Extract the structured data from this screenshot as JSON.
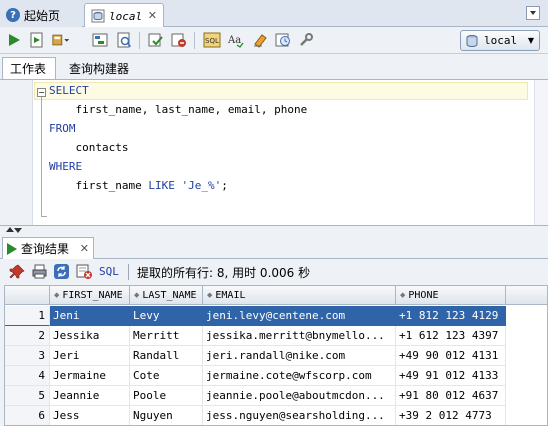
{
  "doc_tabs": {
    "start_page": "起始页",
    "worksheet": "local"
  },
  "toolbar": {
    "icons": [
      "run-statement-icon",
      "run-script-icon",
      "commit-dropdown-icon",
      "explain-plan-icon",
      "autotrace-icon",
      "commit-icon",
      "rollback-icon",
      "sql-tuning-icon",
      "format-icon",
      "clear-icon",
      "history-icon",
      "tools-icon"
    ],
    "connection": "local"
  },
  "worksheet_tabs": {
    "worksheet": "工作表",
    "query_builder": "查询构建器"
  },
  "editor": {
    "lines": [
      {
        "indent": "",
        "parts": [
          {
            "t": "SELECT",
            "c": "kw"
          }
        ]
      },
      {
        "indent": "    ",
        "parts": [
          {
            "t": "first_name, last_name, email, phone",
            "c": ""
          }
        ]
      },
      {
        "indent": "",
        "parts": [
          {
            "t": "FROM",
            "c": "kw"
          }
        ]
      },
      {
        "indent": "    ",
        "parts": [
          {
            "t": "contacts",
            "c": ""
          }
        ]
      },
      {
        "indent": "",
        "parts": [
          {
            "t": "WHERE",
            "c": "kw"
          }
        ]
      },
      {
        "indent": "    ",
        "parts": [
          {
            "t": "first_name ",
            "c": ""
          },
          {
            "t": "LIKE",
            "c": "kw"
          },
          {
            "t": " ",
            "c": ""
          },
          {
            "t": "'Je_%'",
            "c": "str"
          },
          {
            "t": ";",
            "c": ""
          }
        ]
      }
    ]
  },
  "results": {
    "tab_label": "查询结果",
    "sql_link": "SQL",
    "status": "提取的所有行: 8, 用时 0.006 秒",
    "columns": [
      "FIRST_NAME",
      "LAST_NAME",
      "EMAIL",
      "PHONE"
    ],
    "rows": [
      {
        "n": "1",
        "first_name": "Jeni",
        "last_name": "Levy",
        "email": "jeni.levy@centene.com",
        "phone": "+1 812 123 4129"
      },
      {
        "n": "2",
        "first_name": "Jessika",
        "last_name": "Merritt",
        "email": "jessika.merritt@bnymello...",
        "phone": "+1 612 123 4397"
      },
      {
        "n": "3",
        "first_name": "Jeri",
        "last_name": "Randall",
        "email": "jeri.randall@nike.com",
        "phone": "+49 90 012 4131"
      },
      {
        "n": "4",
        "first_name": "Jermaine",
        "last_name": "Cote",
        "email": "jermaine.cote@wfscorp.com",
        "phone": "+49 91 012 4133"
      },
      {
        "n": "5",
        "first_name": "Jeannie",
        "last_name": "Poole",
        "email": "jeannie.poole@aboutmcdon...",
        "phone": "+91 80 012 4637"
      },
      {
        "n": "6",
        "first_name": "Jess",
        "last_name": "Nguyen",
        "email": "jess.nguyen@searsholding...",
        "phone": "+39 2 012 4773"
      }
    ],
    "selected_row": 1
  }
}
